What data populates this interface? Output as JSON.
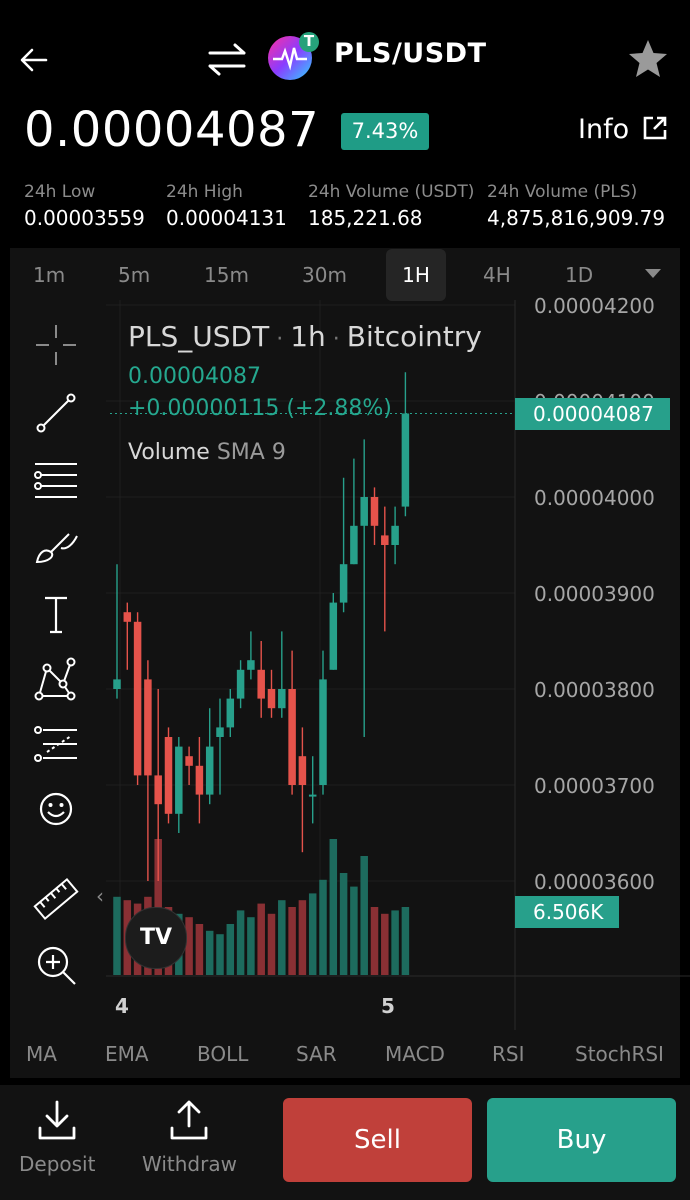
{
  "header": {
    "pair": "PLS/USDT",
    "price": "0.00004087",
    "change": "7.43%",
    "info_label": "Info",
    "badge_glyph": "T"
  },
  "stats": [
    {
      "label": "24h Low",
      "value": "0.00003559"
    },
    {
      "label": "24h High",
      "value": "0.00004131"
    },
    {
      "label": "24h Volume (USDT)",
      "value": "185,221.68"
    },
    {
      "label": "24h Volume (PLS)",
      "value": "4,875,816,909.79"
    }
  ],
  "timeframes": [
    "1m",
    "5m",
    "15m",
    "30m",
    "1H",
    "4H",
    "1D"
  ],
  "active_timeframe": "1H",
  "tools": [
    "crosshair-icon",
    "trend-line-icon",
    "fib-lines-icon",
    "brush-icon",
    "text-icon",
    "pattern-icon",
    "measure-lines-icon",
    "emoji-icon",
    "ruler-icon",
    "zoom-in-icon"
  ],
  "chart": {
    "legend_symbol": "PLS_USDT",
    "legend_interval": "1h",
    "legend_source": "Bitcointry",
    "legend_price": "0.00004087",
    "legend_change": "+0.00000115 (+2.88%)",
    "volume_label": "Volume",
    "volume_sma": "SMA 9",
    "price_tag": "0.00004087",
    "volume_tag": "6.506K",
    "y_labels": [
      "0.00004200",
      "0.00004100",
      "0.00004000",
      "0.00003900",
      "0.00003800",
      "0.00003700",
      "0.00003600"
    ],
    "x_labels": [
      "4",
      "5"
    ],
    "collapse_glyph": "‹",
    "logo_text": "TV",
    "colors": {
      "up": "#27a08b",
      "down": "#e5534b",
      "up_vol": "#1d6b5e",
      "down_vol": "#8a3034"
    }
  },
  "chart_data": {
    "type": "candlestick",
    "ylim": [
      3.5e-05,
      4.25e-05
    ],
    "candles": [
      {
        "o": 3.8e-05,
        "h": 3.93e-05,
        "l": 3.79e-05,
        "c": 3.81e-05,
        "v": 2.3
      },
      {
        "o": 3.88e-05,
        "h": 3.89e-05,
        "l": 3.82e-05,
        "c": 3.87e-05,
        "v": 2.2
      },
      {
        "o": 3.87e-05,
        "h": 3.88e-05,
        "l": 3.7e-05,
        "c": 3.71e-05,
        "v": 2.1
      },
      {
        "o": 3.81e-05,
        "h": 3.83e-05,
        "l": 3.6e-05,
        "c": 3.71e-05,
        "v": 2.3
      },
      {
        "o": 3.71e-05,
        "h": 3.8e-05,
        "l": 3.6e-05,
        "c": 3.68e-05,
        "v": 4.0
      },
      {
        "o": 3.75e-05,
        "h": 3.76e-05,
        "l": 3.66e-05,
        "c": 3.67e-05,
        "v": 2.0
      },
      {
        "o": 3.67e-05,
        "h": 3.75e-05,
        "l": 3.65e-05,
        "c": 3.74e-05,
        "v": 1.8
      },
      {
        "o": 3.73e-05,
        "h": 3.74e-05,
        "l": 3.7e-05,
        "c": 3.72e-05,
        "v": 1.7
      },
      {
        "o": 3.72e-05,
        "h": 3.75e-05,
        "l": 3.66e-05,
        "c": 3.69e-05,
        "v": 1.5
      },
      {
        "o": 3.69e-05,
        "h": 3.78e-05,
        "l": 3.68e-05,
        "c": 3.74e-05,
        "v": 1.3
      },
      {
        "o": 3.75e-05,
        "h": 3.79e-05,
        "l": 3.69e-05,
        "c": 3.76e-05,
        "v": 1.2
      },
      {
        "o": 3.76e-05,
        "h": 3.8e-05,
        "l": 3.75e-05,
        "c": 3.79e-05,
        "v": 1.5
      },
      {
        "o": 3.79e-05,
        "h": 3.83e-05,
        "l": 3.78e-05,
        "c": 3.82e-05,
        "v": 1.9
      },
      {
        "o": 3.82e-05,
        "h": 3.86e-05,
        "l": 3.81e-05,
        "c": 3.83e-05,
        "v": 1.7
      },
      {
        "o": 3.82e-05,
        "h": 3.85e-05,
        "l": 3.77e-05,
        "c": 3.79e-05,
        "v": 2.1
      },
      {
        "o": 3.8e-05,
        "h": 3.82e-05,
        "l": 3.77e-05,
        "c": 3.78e-05,
        "v": 1.8
      },
      {
        "o": 3.78e-05,
        "h": 3.86e-05,
        "l": 3.77e-05,
        "c": 3.8e-05,
        "v": 2.2
      },
      {
        "o": 3.8e-05,
        "h": 3.84e-05,
        "l": 3.69e-05,
        "c": 3.7e-05,
        "v": 2.0
      },
      {
        "o": 3.73e-05,
        "h": 3.76e-05,
        "l": 3.63e-05,
        "c": 3.7e-05,
        "v": 2.2
      },
      {
        "o": 3.69e-05,
        "h": 3.73e-05,
        "l": 3.66e-05,
        "c": 3.69e-05,
        "v": 2.4
      },
      {
        "o": 3.7e-05,
        "h": 3.84e-05,
        "l": 3.69e-05,
        "c": 3.81e-05,
        "v": 2.8
      },
      {
        "o": 3.82e-05,
        "h": 3.9e-05,
        "l": 3.82e-05,
        "c": 3.89e-05,
        "v": 4.0
      },
      {
        "o": 3.89e-05,
        "h": 4.02e-05,
        "l": 3.88e-05,
        "c": 3.93e-05,
        "v": 3.0
      },
      {
        "o": 3.93e-05,
        "h": 4.04e-05,
        "l": 3.93e-05,
        "c": 3.97e-05,
        "v": 2.6
      },
      {
        "o": 3.97e-05,
        "h": 4.06e-05,
        "l": 3.75e-05,
        "c": 4e-05,
        "v": 3.5
      },
      {
        "o": 4e-05,
        "h": 4.01e-05,
        "l": 3.95e-05,
        "c": 3.97e-05,
        "v": 2.0
      },
      {
        "o": 3.96e-05,
        "h": 3.99e-05,
        "l": 3.86e-05,
        "c": 3.95e-05,
        "v": 1.8
      },
      {
        "o": 3.95e-05,
        "h": 3.99e-05,
        "l": 3.93e-05,
        "c": 3.97e-05,
        "v": 1.9
      },
      {
        "o": 3.99e-05,
        "h": 4.13e-05,
        "l": 3.98e-05,
        "c": 4.087e-05,
        "v": 2.0
      }
    ]
  },
  "indicators": [
    "MA",
    "EMA",
    "BOLL",
    "SAR",
    "MACD",
    "RSI",
    "StochRSI"
  ],
  "actions": {
    "deposit": "Deposit",
    "withdraw": "Withdraw",
    "sell": "Sell",
    "buy": "Buy"
  }
}
